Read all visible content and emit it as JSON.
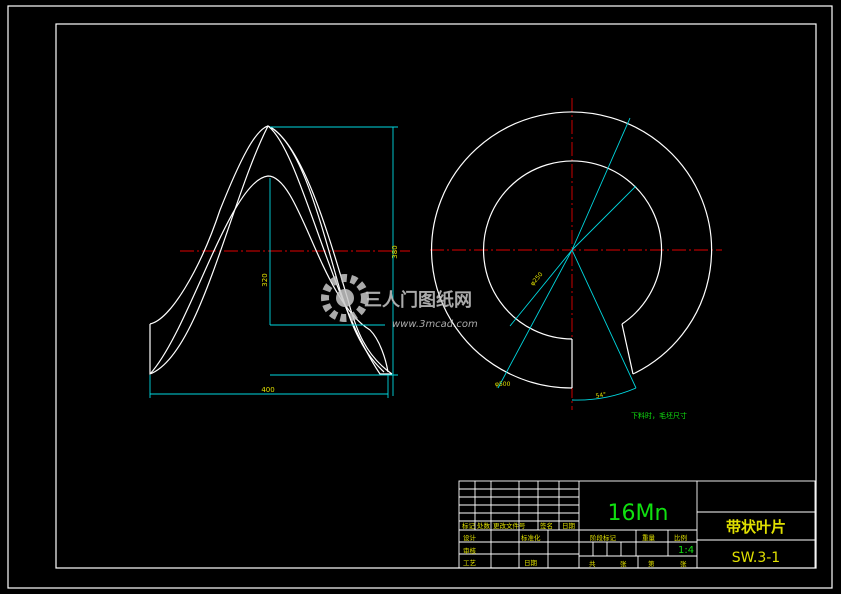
{
  "drawing": {
    "dims": {
      "width_label": "400",
      "height_label_right": "380",
      "height_label_inner": "320",
      "inner_dia_label": "φ250",
      "outer_dia_label": "φ500",
      "angle_label": "54°"
    },
    "note": "下料时，毛坯尺寸"
  },
  "title_block": {
    "material": "16Mn",
    "part_name": "带状叶片",
    "drawing_no": "SW.3-1",
    "scale": "1:4",
    "labels": {
      "mark": "标记",
      "count": "处数",
      "zone": "分区",
      "change_doc": "更改文件号",
      "signature": "签名",
      "date_col": "日期",
      "designer": "设计",
      "standardize": "标准化",
      "stage_mark": "阶段标记",
      "weight": "重量",
      "scale_label": "比例",
      "checker": "审核",
      "process": "工艺",
      "approve_date": "日期",
      "total": "共",
      "sheet": "张",
      "nth": "第",
      "page": "张"
    }
  },
  "watermark": {
    "brand": "三人门图纸网",
    "url": "www.3mcad.com"
  },
  "colors": {
    "background": "#000000",
    "outline": "#ffffff",
    "dimension": "#00d8e0",
    "centerline": "#e00000",
    "text_green": "#10e010",
    "text_yellow": "#e0e000"
  }
}
